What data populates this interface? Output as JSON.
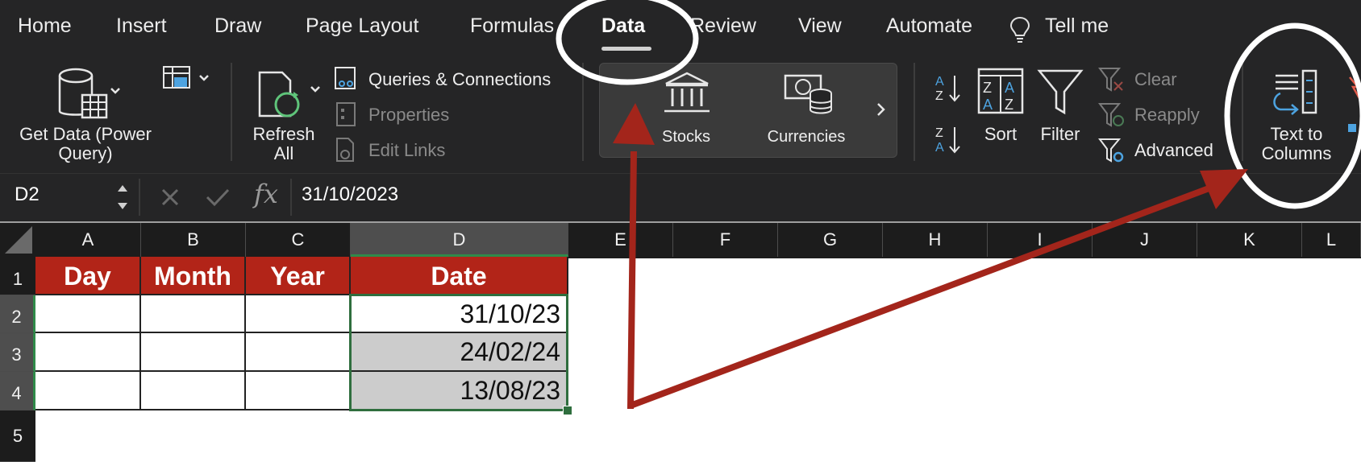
{
  "tabs": [
    {
      "label": "Home"
    },
    {
      "label": "Insert"
    },
    {
      "label": "Draw"
    },
    {
      "label": "Page Layout"
    },
    {
      "label": "Formulas"
    },
    {
      "label": "Data",
      "active": true
    },
    {
      "label": "Review"
    },
    {
      "label": "View"
    },
    {
      "label": "Automate"
    },
    {
      "label": "Tell me",
      "icon": "lightbulb-icon"
    }
  ],
  "ribbon": {
    "get_data": "Get Data (Power\nQuery)",
    "refresh_all": "Refresh\nAll",
    "queries_connections": "Queries & Connections",
    "properties": "Properties",
    "edit_links": "Edit Links",
    "stocks": "Stocks",
    "currencies": "Currencies",
    "sort": "Sort",
    "filter": "Filter",
    "clear": "Clear",
    "reapply": "Reapply",
    "advanced": "Advanced",
    "text_to_columns": "Text to\nColumns"
  },
  "formula_bar": {
    "name_box": "D2",
    "fx": "fx",
    "value": "31/10/2023"
  },
  "grid": {
    "columns": [
      "A",
      "B",
      "C",
      "D",
      "E",
      "F",
      "G",
      "H",
      "I",
      "J",
      "K",
      "L"
    ],
    "rows": [
      "1",
      "2",
      "3",
      "4",
      "5"
    ],
    "selected_column": "D",
    "headers": [
      "Day",
      "Month",
      "Year",
      "Date"
    ],
    "dates": [
      "31/10/23",
      "24/02/24",
      "13/08/23"
    ]
  },
  "colors": {
    "ribbon_bg": "#252526",
    "header_fill": "#b22418",
    "selection_green": "#2f8a4a",
    "annotation_red": "#a3251b"
  }
}
